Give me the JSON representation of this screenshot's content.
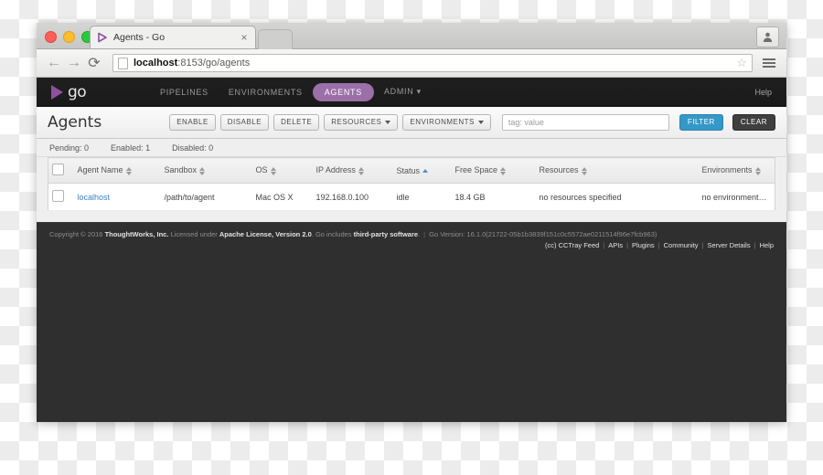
{
  "browser": {
    "tab_title": "Agents - Go",
    "tab_close_label": "×",
    "url_host": "localhost",
    "url_rest": ":8153/go/agents",
    "back_glyph": "←",
    "forward_glyph": "→",
    "reload_glyph": "⟳",
    "star_glyph": "☆",
    "profile_glyph": "●"
  },
  "nav": {
    "logo_text": "go",
    "links": [
      {
        "label": "PIPELINES",
        "active": false
      },
      {
        "label": "ENVIRONMENTS",
        "active": false
      },
      {
        "label": "AGENTS",
        "active": true
      },
      {
        "label": "ADMIN ▾",
        "active": false
      }
    ],
    "help_label": "Help"
  },
  "header": {
    "title": "Agents",
    "buttons": [
      {
        "label": "ENABLE",
        "caret": false
      },
      {
        "label": "DISABLE",
        "caret": false
      },
      {
        "label": "DELETE",
        "caret": false
      },
      {
        "label": "RESOURCES",
        "caret": true
      },
      {
        "label": "ENVIRONMENTS",
        "caret": true
      }
    ],
    "filter_placeholder": "tag: value",
    "filter_value": "",
    "filter_button": "FILTER",
    "clear_button": "CLEAR"
  },
  "counts": {
    "pending": "Pending: 0",
    "enabled": "Enabled: 1",
    "disabled": "Disabled: 0"
  },
  "table": {
    "columns": [
      {
        "label": "Agent Name",
        "sort": "both"
      },
      {
        "label": "Sandbox",
        "sort": "both"
      },
      {
        "label": "OS",
        "sort": "both"
      },
      {
        "label": "IP Address",
        "sort": "both"
      },
      {
        "label": "Status",
        "sort": "asc"
      },
      {
        "label": "Free Space",
        "sort": "both"
      },
      {
        "label": "Resources",
        "sort": "both"
      },
      {
        "label": "Environments",
        "sort": "both"
      }
    ],
    "rows": [
      {
        "agent_name": "localhost",
        "sandbox": "/path/to/agent",
        "os": "Mac OS X",
        "ip_address": "192.168.0.100",
        "status": "idle",
        "free_space": "18.4 GB",
        "resources": "no resources specified",
        "environments": "no environments specified"
      }
    ]
  },
  "footer": {
    "copyright_pre": "Copyright © 2016 ",
    "company": "ThoughtWorks, Inc.",
    "license_pre": " Licensed under ",
    "license": "Apache License, Version 2.0",
    "includes_pre": ". Go includes ",
    "third_party": "third-party software",
    "period": ".",
    "go_version": "Go Version: 16.1.0(21722-05b1b3839f151c0c5572ae0211514f96e7fcb963)",
    "links": [
      "(cc) CCTray Feed",
      "APIs",
      "Plugins",
      "Community",
      "Server Details",
      "Help"
    ]
  },
  "colors": {
    "brand_purple": "#8e51a0",
    "active_pill": "#9b6fa8",
    "filter_blue": "#3498c8",
    "link_blue": "#3b84c6",
    "chrome_dark": "#2f2f2f"
  }
}
